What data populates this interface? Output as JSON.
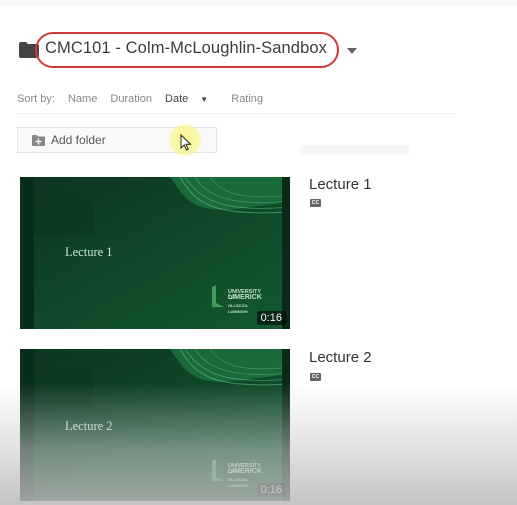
{
  "folder": {
    "title": "CMC101 - Colm-McLoughlin-Sandbox",
    "icon": "folder-icon",
    "dropdown_icon": "caret-down-icon"
  },
  "sort": {
    "label": "Sort by:",
    "options": [
      "Name",
      "Duration",
      "Date",
      "Rating"
    ],
    "active": "Date",
    "active_icon": "caret-down-icon"
  },
  "add_folder": {
    "label": "Add folder",
    "icon": "add-folder-icon"
  },
  "videos": [
    {
      "title": "Lecture 1",
      "slide_text": "Lecture 1",
      "duration": "0:16",
      "captions_icon": "cc-icon"
    },
    {
      "title": "Lecture 2",
      "slide_text": "Lecture 2",
      "duration": "0:16",
      "captions_icon": "cc-icon"
    }
  ],
  "logo_text": [
    "UNIVERSITY OF",
    "LIMERICK",
    "OLLSCOIL LUIMNIGH"
  ],
  "cc_text": "CC",
  "colors": {
    "highlight_outline": "#d23a3a",
    "thumbnail_green": "#0f3f23",
    "cursor_halo": "#faf68c"
  }
}
